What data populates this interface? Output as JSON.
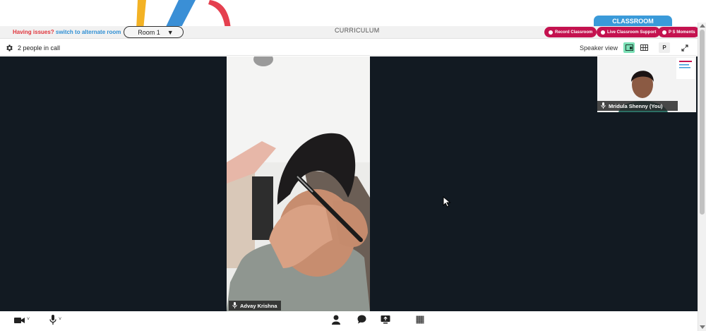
{
  "topbar": {
    "issue_prefix": "Having issues?",
    "issue_link": "switch to alternate room",
    "room_selected": "Room 1",
    "curriculum_label": "CURRICULUM",
    "classroom_tab": "CLASSROOM",
    "record_label": "Record Classroom",
    "support_label": "Live Classroom Support",
    "moments_label": "P S Moments"
  },
  "call": {
    "people_count_label": "2 people in call",
    "speaker_view_label": "Speaker view",
    "p_label": "P"
  },
  "participants": {
    "main_name": "Advay Krishna",
    "self_name": "Mridula Shenny (You)"
  },
  "colors": {
    "accent_blue": "#3a9ad9",
    "accent_red": "#c4124f",
    "active_view": "#7be0b6",
    "stage_bg": "#121a22"
  },
  "icons": [
    "gear-icon",
    "speaker-view-icon",
    "grid-view-icon",
    "fullscreen-icon",
    "camera-icon",
    "microphone-icon",
    "participants-icon",
    "chat-icon",
    "screen-share-icon",
    "whiteboard-icon"
  ]
}
